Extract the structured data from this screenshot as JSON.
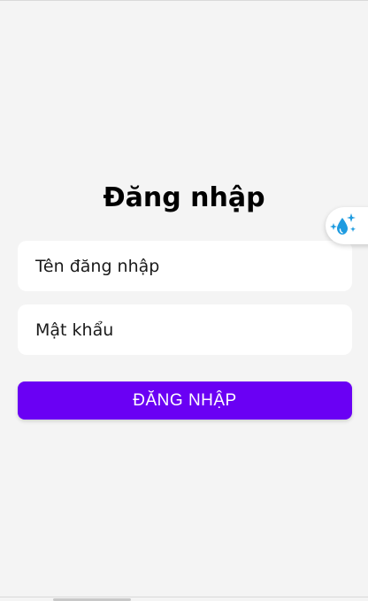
{
  "login": {
    "title": "Đăng nhập",
    "username_placeholder": "Tên đăng nhập",
    "password_placeholder": "Mật khẩu",
    "submit_label": "ĐĂNG NHẬP"
  },
  "theme": {
    "background": "#f4f4f4",
    "accent": "#6a00f4",
    "float_icon_color": "#1e9be0"
  },
  "float_widget": {
    "icon": "water-drop-sparkle-icon"
  }
}
